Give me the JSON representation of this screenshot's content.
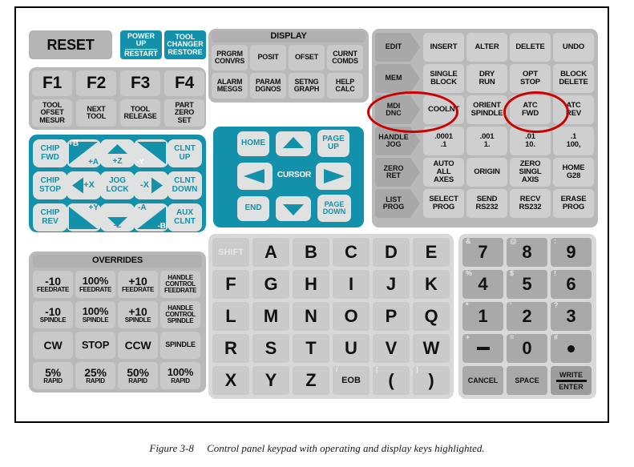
{
  "caption": {
    "figure": "Figure 3-8",
    "text": "Control panel keypad with operating and display keys highlighted."
  },
  "colors": {
    "teal": "#1391ab",
    "key_gray": "#c9c9c9",
    "mode_gray": "#a8a8a8",
    "highlight_red": "#cc0000",
    "panel_gray": "#b9b9b9"
  },
  "left": {
    "reset": "RESET",
    "power_up": {
      "line1": "POWER",
      "line2": "UP",
      "line3": "RESTART"
    },
    "tool_changer": {
      "line1": "TOOL",
      "line2": "CHANGER",
      "line3": "RESTORE"
    },
    "function_keys": [
      "F1",
      "F2",
      "F3",
      "F4"
    ],
    "tool_keys": [
      {
        "lines": [
          "TOOL",
          "OFSET",
          "MESUR"
        ]
      },
      {
        "lines": [
          "NEXT",
          "TOOL"
        ]
      },
      {
        "lines": [
          "TOOL",
          "RELEASE"
        ]
      },
      {
        "lines": [
          "PART",
          "ZERO",
          "SET"
        ]
      }
    ]
  },
  "jog": {
    "keys": [
      {
        "name": "chip-fwd",
        "lines": [
          "CHIP",
          "FWD"
        ],
        "glyph": "none"
      },
      {
        "name": "plus-b-plus-a",
        "tl": "+B",
        "br": "+A",
        "glyph": "tri-ul"
      },
      {
        "name": "plus-z",
        "center": "+Z",
        "glyph": "arrow-up"
      },
      {
        "name": "minus-y",
        "bl": "-Y",
        "glyph": "tri-ur"
      },
      {
        "name": "clnt-up",
        "lines": [
          "CLNT",
          "UP"
        ],
        "glyph": "none"
      },
      {
        "name": "chip-stop",
        "lines": [
          "CHIP",
          "STOP"
        ],
        "glyph": "none"
      },
      {
        "name": "plus-x",
        "label": "+X",
        "glyph": "arrow-left"
      },
      {
        "name": "jog-lock",
        "lines": [
          "JOG",
          "LOCK"
        ],
        "glyph": "none"
      },
      {
        "name": "minus-x",
        "label": "-X",
        "glyph": "arrow-right"
      },
      {
        "name": "clnt-down",
        "lines": [
          "CLNT",
          "DOWN"
        ],
        "glyph": "none"
      },
      {
        "name": "chip-rev",
        "lines": [
          "CHIP",
          "REV"
        ],
        "glyph": "none"
      },
      {
        "name": "plus-y",
        "tr": "+Y",
        "glyph": "tri-bl"
      },
      {
        "name": "minus-z",
        "center": "-Z",
        "glyph": "arrow-down"
      },
      {
        "name": "minus-a-minus-b",
        "tl2": "-A",
        "br2": "-B",
        "glyph": "tri-br"
      },
      {
        "name": "aux-clnt",
        "lines": [
          "AUX",
          "CLNT"
        ],
        "glyph": "none"
      }
    ]
  },
  "overrides": {
    "title": "OVERRIDES",
    "rows": [
      [
        {
          "big": "-10",
          "small": "FEEDRATE"
        },
        {
          "big": "100%",
          "small": "FEEDRATE"
        },
        {
          "big": "+10",
          "small": "FEEDRATE"
        },
        {
          "lines3": [
            "HANDLE",
            "CONTROL",
            "FEEDRATE"
          ]
        }
      ],
      [
        {
          "big": "-10",
          "small": "SPINDLE"
        },
        {
          "big": "100%",
          "small": "SPINDLE"
        },
        {
          "big": "+10",
          "small": "SPINDLE"
        },
        {
          "lines3": [
            "HANDLE",
            "CONTROL",
            "SPINDLE"
          ]
        }
      ],
      [
        {
          "big": "CW"
        },
        {
          "big": "STOP"
        },
        {
          "big": "CCW"
        },
        {
          "small_only": "SPINDLE"
        }
      ],
      [
        {
          "big": "5%",
          "small": "RAPID"
        },
        {
          "big": "25%",
          "small": "RAPID"
        },
        {
          "big": "50%",
          "small": "RAPID"
        },
        {
          "big": "100%",
          "small": "RAPID"
        }
      ]
    ]
  },
  "display": {
    "title": "DISPLAY",
    "keys": [
      {
        "lines": [
          "PRGRM",
          "CONVRS"
        ]
      },
      {
        "lines": [
          "POSIT"
        ]
      },
      {
        "lines": [
          "OFSET"
        ]
      },
      {
        "lines": [
          "CURNT",
          "COMDS"
        ]
      },
      {
        "lines": [
          "ALARM",
          "MESGS"
        ]
      },
      {
        "lines": [
          "PARAM",
          "DGNOS"
        ]
      },
      {
        "lines": [
          "SETNG",
          "GRAPH"
        ]
      },
      {
        "lines": [
          "HELP",
          "CALC"
        ]
      }
    ]
  },
  "cursor": {
    "label": "CURSOR",
    "home": "HOME",
    "page_up": {
      "l1": "PAGE",
      "l2": "UP"
    },
    "end": "END",
    "page_down": {
      "l1": "PAGE",
      "l2": "DOWN"
    },
    "up_icon": "arrow-up-icon",
    "down_icon": "arrow-down-icon",
    "left_icon": "arrow-left-icon",
    "right_icon": "arrow-right-icon"
  },
  "modes": {
    "rows": [
      {
        "mode": {
          "lines": [
            "EDIT"
          ]
        },
        "keys": [
          {
            "lines": [
              "INSERT"
            ]
          },
          {
            "lines": [
              "ALTER"
            ]
          },
          {
            "lines": [
              "DELETE"
            ]
          },
          {
            "lines": [
              "UNDO"
            ]
          }
        ]
      },
      {
        "mode": {
          "lines": [
            "MEM"
          ]
        },
        "keys": [
          {
            "lines": [
              "SINGLE",
              "BLOCK"
            ]
          },
          {
            "lines": [
              "DRY",
              "RUN"
            ]
          },
          {
            "lines": [
              "OPT",
              "STOP"
            ]
          },
          {
            "lines": [
              "BLOCK",
              "DELETE"
            ]
          }
        ]
      },
      {
        "mode": {
          "lines": [
            "MDI",
            "DNC"
          ]
        },
        "keys": [
          {
            "lines": [
              "COOLNT"
            ]
          },
          {
            "lines": [
              "ORIENT",
              "SPINDLE"
            ]
          },
          {
            "lines": [
              "ATC",
              "FWD"
            ]
          },
          {
            "lines": [
              "ATC",
              "REV"
            ]
          }
        ]
      },
      {
        "mode": {
          "lines": [
            "HANDLE",
            "JOG"
          ]
        },
        "keys": [
          {
            "lines": [
              ".0001",
              ".1"
            ]
          },
          {
            "lines": [
              ".001",
              "1."
            ]
          },
          {
            "lines": [
              ".01",
              "10."
            ]
          },
          {
            "lines": [
              ".1",
              "100,"
            ]
          }
        ]
      },
      {
        "mode": {
          "lines": [
            "ZERO",
            "RET"
          ]
        },
        "keys": [
          {
            "lines": [
              "AUTO",
              "ALL",
              "AXES"
            ]
          },
          {
            "lines": [
              "ORIGIN"
            ]
          },
          {
            "lines": [
              "ZERO",
              "SINGL",
              "AXIS"
            ]
          },
          {
            "lines": [
              "HOME",
              "G28"
            ]
          }
        ]
      },
      {
        "mode": {
          "lines": [
            "LIST",
            "PROG"
          ]
        },
        "keys": [
          {
            "lines": [
              "SELECT",
              "PROG"
            ]
          },
          {
            "lines": [
              "SEND",
              "RS232"
            ]
          },
          {
            "lines": [
              "RECV",
              "RS232"
            ]
          },
          {
            "lines": [
              "ERASE",
              "PROG"
            ]
          }
        ]
      }
    ],
    "highlighted": [
      "MDI DNC",
      "ATC FWD"
    ]
  },
  "alpha": {
    "rows": [
      [
        {
          "t": "SHIFT",
          "shift": true
        },
        {
          "t": "A"
        },
        {
          "t": "B"
        },
        {
          "t": "C"
        },
        {
          "t": "D"
        },
        {
          "t": "E"
        }
      ],
      [
        {
          "t": "F"
        },
        {
          "t": "G"
        },
        {
          "t": "H"
        },
        {
          "t": "I"
        },
        {
          "t": "J"
        },
        {
          "t": "K"
        }
      ],
      [
        {
          "t": "L"
        },
        {
          "t": "M"
        },
        {
          "t": "N"
        },
        {
          "t": "O"
        },
        {
          "t": "P"
        },
        {
          "t": "Q"
        }
      ],
      [
        {
          "t": "R"
        },
        {
          "t": "S"
        },
        {
          "t": "T"
        },
        {
          "t": "U"
        },
        {
          "t": "V"
        },
        {
          "t": "W"
        }
      ],
      [
        {
          "t": "X"
        },
        {
          "t": "Y"
        },
        {
          "t": "Z"
        },
        {
          "t": "EOB",
          "sup": "/",
          "small": true
        },
        {
          "t": "(",
          "sup": "["
        },
        {
          "t": ")",
          "sup": "]"
        }
      ]
    ]
  },
  "numpad": {
    "rows": [
      [
        {
          "t": "7",
          "sup": "&"
        },
        {
          "t": "8",
          "sup": "@"
        },
        {
          "t": "9",
          "sup": ":"
        }
      ],
      [
        {
          "t": "4",
          "sup": "%"
        },
        {
          "t": "5",
          "sup": "$"
        },
        {
          "t": "6",
          "sup": "!"
        }
      ],
      [
        {
          "t": "1",
          "sup": "*"
        },
        {
          "t": "2",
          "sup": "'"
        },
        {
          "t": "3",
          "sup": "?"
        }
      ],
      [
        {
          "t": "-",
          "sup": "+",
          "shape": "minus"
        },
        {
          "t": "0",
          "sup": "="
        },
        {
          "t": ".",
          "sup": "#",
          "shape": "dot"
        }
      ]
    ],
    "bottom": {
      "cancel": "CANCEL",
      "space": "SPACE",
      "write": "WRITE",
      "enter": "ENTER"
    }
  }
}
